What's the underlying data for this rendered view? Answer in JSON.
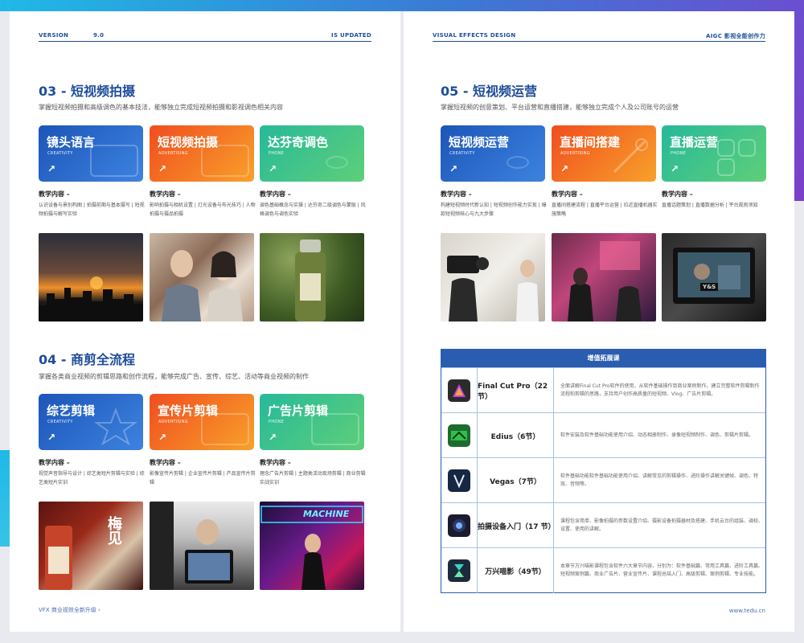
{
  "left_header": {
    "version": "VERSION",
    "version_num": "9.0",
    "status": "IS UPDATED"
  },
  "right_header": {
    "left": "VISUAL EFFECTS DESIGN",
    "right": "AIGC 影视全能创作力"
  },
  "left_footer": "VFX 商业视效全新升级 ›",
  "right_footer": "www.tedu.cn",
  "section03": {
    "title": "03 - 短视频拍摄",
    "subtitle": "掌握短视频拍摄和高级调色的基本技法，能够独立完成短视频拍摄和影视调色相关内容",
    "cards": [
      {
        "title": "镜头语言",
        "sub": "CREATIVITY",
        "color": "blue",
        "label": "教学内容 –",
        "desc": "认识设备与景别构图 | 拍摄前期与基本摄写 | 短视频拍摄与解写实验"
      },
      {
        "title": "短视频拍摄",
        "sub": "ADVERTISING",
        "color": "orange",
        "label": "教学内容 –",
        "desc": "影响拍摄与相机设置 | 灯光设备与布光技巧 | 人物拍摄与摄品拍摄"
      },
      {
        "title": "达芬奇调色",
        "sub": "PHONE",
        "color": "green",
        "label": "教学内容 –",
        "desc": "调色基础概念与实操 | 达芬奇二级调色与蒙版 | 风格调色与调色实验"
      }
    ]
  },
  "section04": {
    "title": "04 - 商剪全流程",
    "subtitle": "掌握各类商业视频的剪辑思路和创作流程，能够完成广告、宣传、综艺、活动等商业视频的制作",
    "cards": [
      {
        "title": "综艺剪辑",
        "sub": "CREATIVITY",
        "color": "blue",
        "label": "教学内容 –",
        "desc": "视觉声音指导与设计 | 综艺类短片剪辑与实验 | 综艺类短片实训"
      },
      {
        "title": "宣传片剪辑",
        "sub": "ADVERTISING",
        "color": "orange",
        "label": "教学内容 –",
        "desc": "影像宣传片剪辑 | 企业宣传片剪辑 | 产品宣传片剪辑"
      },
      {
        "title": "广告片剪辑",
        "sub": "PHONE",
        "color": "green",
        "label": "教学内容 –",
        "desc": "理念广告片剪辑 | 主题类活动现场剪辑 | 商业剪辑实战实训"
      }
    ]
  },
  "section05": {
    "title": "05 - 短视频运营",
    "subtitle": "掌握短视频的创意策划、平台运营和直播搭建，能够独立完成个人及公司账号的运营",
    "cards": [
      {
        "title": "短视频运营",
        "sub": "CREATIVITY",
        "color": "blue",
        "label": "教学内容 –",
        "desc": "构建短视频时代新认知 | 短视频创作能力实现 | 爆款短视频核心与九大步骤"
      },
      {
        "title": "直播间搭建",
        "sub": "ADVERTISING",
        "color": "orange",
        "label": "教学内容 –",
        "desc": "直播间搭建流程 | 直播平台运营 | 拉近直播机器实施策略"
      },
      {
        "title": "直播运营",
        "sub": "PHONE",
        "color": "green",
        "label": "教学内容 –",
        "desc": "直播话题策划 | 直播数据分析 | 平台规则须知"
      }
    ]
  },
  "photos": {
    "p1": "",
    "p2": "",
    "p3": "",
    "p4": "梅见",
    "p5": "",
    "p6": "MACHINE",
    "p7": "",
    "p8": "",
    "p9": "Y&S"
  },
  "table": {
    "title": "增值拓展课",
    "rows": [
      {
        "name": "Final Cut Pro（22 节）",
        "icon": "final-cut-pro-icon",
        "color": "#2b2b2b",
        "desc": "全面讲解Final Cut Pro软件的使用，从软件基础操作到商业案例制作。建立完整软件剪辑制作流程和剪辑的思路，支持用户创作高质量的短视频、Vlog、广告片剪辑。"
      },
      {
        "name": "Edius（6节）",
        "icon": "edius-icon",
        "color": "#1d6b2e",
        "desc": "软件安装及软件基础功能使用介绍、动态相册制作、录像短视频制作、调色、剪辑片剪辑。"
      },
      {
        "name": "Vegas（7节）",
        "icon": "vegas-icon",
        "color": "#162744",
        "desc": "软件基础功能软件基础功能使用介绍、讲解常见的剪辑操作、进阶操作讲解关键帧、调色、特效、音频等。"
      },
      {
        "name": "拍摄设备入门（17 节）",
        "icon": "camera-icon",
        "color": "#1b1b2e",
        "desc": "课程包含简单、影像拍摄的参数设置介绍、摄影设备拍摄器材及搭建、手机云台的组装、调校、设置、使用的讲解。"
      },
      {
        "name": "万兴喵影（49节）",
        "icon": "filmora-icon",
        "color": "#1c2b3c",
        "desc": "本章节万兴喵影课程包含软件六大章节内容，分别为：软件基础篇、常用工具篇、进阶工具篇、短视频案例篇、商业广告片、营业宣传片、课程总结入门、高级剪辑、案例剪辑、专业技能。"
      }
    ]
  }
}
